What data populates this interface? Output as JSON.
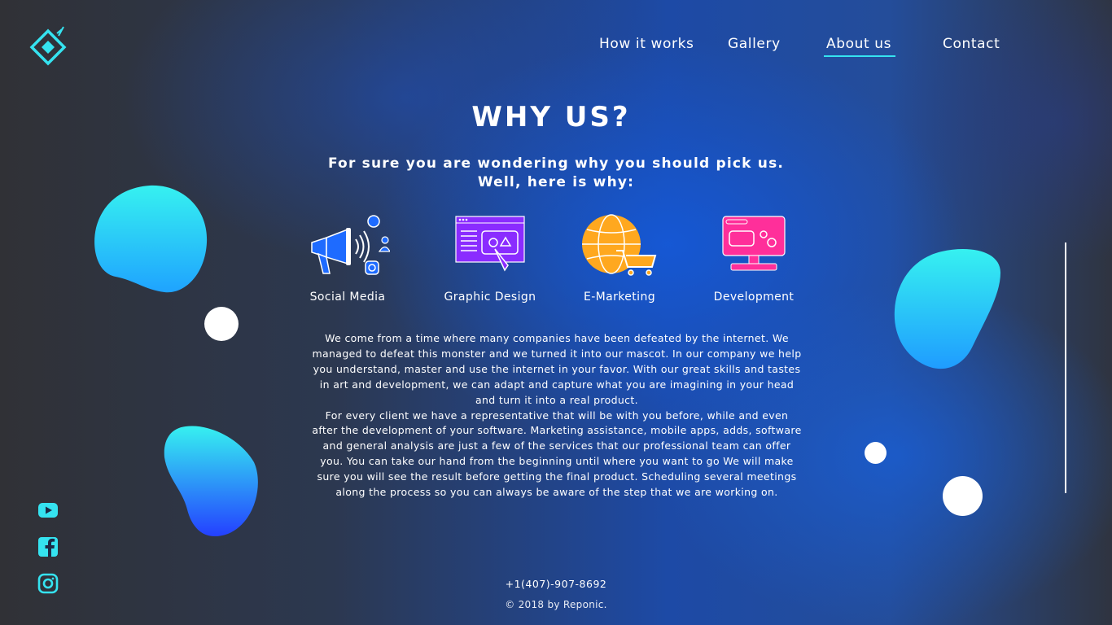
{
  "nav": {
    "items": [
      {
        "label": "How it works"
      },
      {
        "label": "Gallery"
      },
      {
        "label": "About us",
        "active": true
      },
      {
        "label": "Contact"
      }
    ]
  },
  "hero": {
    "title": "WHY US?",
    "subtitle_line1": "For sure you are wondering why you should pick us.",
    "subtitle_line2": "Well, here is why:"
  },
  "services": [
    {
      "label": "Social Media",
      "icon": "megaphone-icon"
    },
    {
      "label": "Graphic Design",
      "icon": "design-window-icon"
    },
    {
      "label": "E-Marketing",
      "icon": "globe-cart-icon"
    },
    {
      "label": "Development",
      "icon": "monitor-icon"
    }
  ],
  "body": {
    "paragraph1": "We come from a time where many companies have been defeated by the internet. We managed to defeat this monster and we turned it into our mascot. In our company we help you understand, master and use the internet in your favor. With our great skills and tastes in art and development, we can adapt and capture what you are imagining in your head and turn it into a real product.",
    "paragraph2": "For every client we have a representative that will be with you before, while and even after the development of your software. Marketing assistance, mobile apps, adds, software and general analysis are just a few of the services that our professional team can offer you. You can take our hand from the beginning until where you want to go We will make sure you will see the result before getting the final product. Scheduling several meetings along the process so you can always be aware of the step that we are working on."
  },
  "social": [
    {
      "icon": "youtube-icon"
    },
    {
      "icon": "facebook-icon"
    },
    {
      "icon": "instagram-icon"
    }
  ],
  "footer": {
    "phone": "+1(407)-907-8692",
    "copyright": "© 2018 by Reponic."
  },
  "colors": {
    "accent": "#35e3f0",
    "blob_top": "#33f0f0",
    "blob_bottom": "#1f55ff",
    "icon_blue": "#1e6bff",
    "icon_purple": "#8a2cff",
    "icon_orange": "#ffa81f",
    "icon_pink": "#ff2f9a"
  }
}
